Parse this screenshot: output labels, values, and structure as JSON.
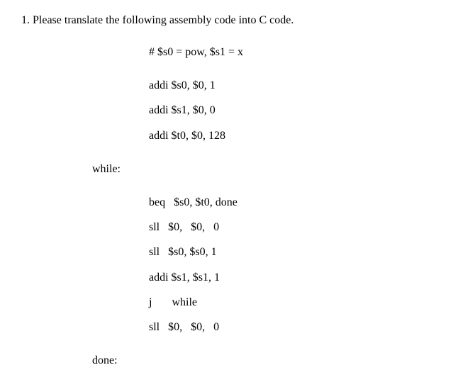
{
  "question": {
    "number": "1.",
    "prompt": "Please translate the following assembly code into C code."
  },
  "code": {
    "comment": "# $s0 = pow, $s1 = x",
    "init": [
      "addi $s0, $0, 1",
      "addi $s1, $0, 0",
      "addi $t0, $0, 128"
    ],
    "label_while": "while:",
    "body": [
      "beq   $s0, $t0, done",
      "sll   $0,   $0,   0",
      "sll   $s0, $s0, 1",
      "addi $s1, $s1, 1",
      "j       while",
      "sll   $0,   $0,   0"
    ],
    "label_done": "done:"
  }
}
